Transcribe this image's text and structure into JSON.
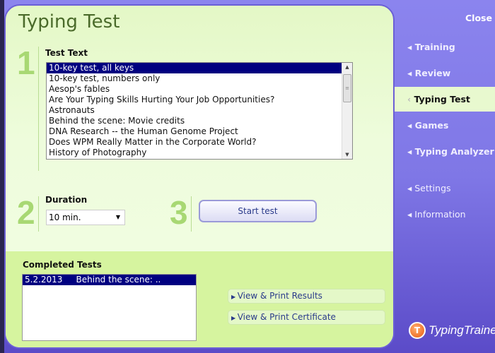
{
  "window": {
    "title": "Typing Test",
    "close_label": "Close"
  },
  "steps": [
    "1",
    "2",
    "3"
  ],
  "test_text": {
    "label": "Test Text",
    "items": [
      "10-key test, all keys",
      "10-key test, numbers only",
      "Aesop's fables",
      "Are Your Typing Skills Hurting Your Job Opportunities?",
      "Astronauts",
      "Behind the scene: Movie credits",
      "DNA Research -- the Human Genome Project",
      "Does WPM Really Matter in the Corporate World?",
      "History of Photography"
    ],
    "selected": "10-key test, all keys"
  },
  "duration": {
    "label": "Duration",
    "value": "10 min."
  },
  "start_label": "Start test",
  "completed": {
    "label": "Completed Tests",
    "items": [
      {
        "date": "5.2.2013",
        "name": "Behind the scene: .."
      }
    ]
  },
  "actions": {
    "results": "View & Print Results",
    "certificate": "View & Print Certificate"
  },
  "nav": [
    {
      "label": "Training"
    },
    {
      "label": "Review"
    },
    {
      "label": "Typing Test",
      "active": true
    },
    {
      "label": "Games"
    },
    {
      "label": "Typing Analyzer"
    },
    {
      "label": "Settings"
    },
    {
      "label": "Information"
    }
  ],
  "logo": "TypingTrainer",
  "colors": {
    "accent": "#7f77e6",
    "panel": "#eefcdc",
    "selection": "#000080",
    "step_number": "#a8d873"
  }
}
